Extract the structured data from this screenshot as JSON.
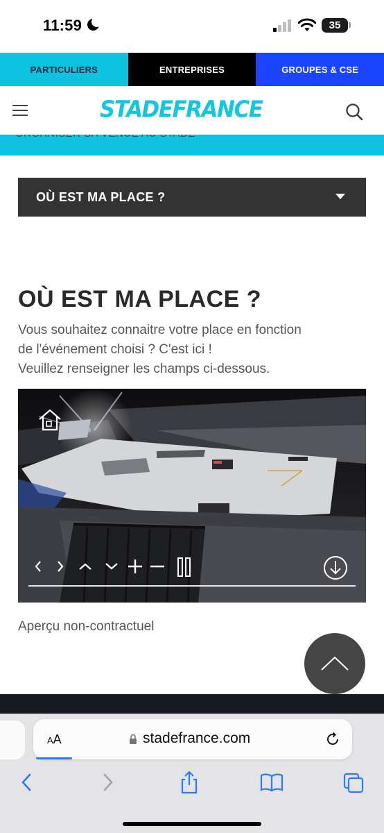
{
  "status_bar": {
    "time": "11:59",
    "battery": "35"
  },
  "top_tabs": [
    {
      "label": "PARTICULIERS",
      "color": "#0fc3e0"
    },
    {
      "label": "ENTREPRISES",
      "color": "#000000"
    },
    {
      "label": "GROUPES & CSE",
      "color": "#1a44ff"
    }
  ],
  "header": {
    "logo": "STADEFRANCE",
    "brand_color": "#12c6e0"
  },
  "sub_banner": {
    "text": "ORGANISER SA VENUE AU STADE"
  },
  "accordion": {
    "label": "OÙ EST MA PLACE ?"
  },
  "section": {
    "title": "OÙ EST MA PLACE ?",
    "intro_lines": [
      "Vous souhaitez connaitre votre place en fonction",
      "de l'événement choisi ? C'est ici !",
      "Veuillez renseigner les champs ci-dessous."
    ]
  },
  "viewer": {
    "controls": [
      "chevron-left-icon",
      "chevron-right-icon",
      "chevron-up-icon",
      "chevron-down-icon",
      "zoom-in-icon",
      "zoom-out-icon",
      "pause-icon",
      "download-icon",
      "home-icon"
    ]
  },
  "caption": "Aperçu non-contractuel",
  "browser": {
    "aa_label": "AA",
    "url": "stadefrance.com"
  }
}
